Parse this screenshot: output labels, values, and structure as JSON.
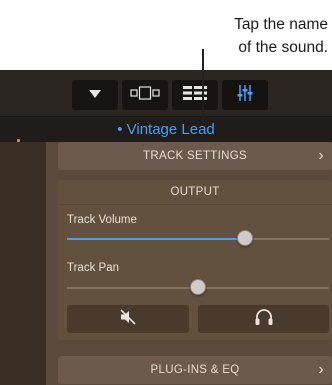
{
  "callout": {
    "text_line1": "Tap the name",
    "text_line2": "of the sound."
  },
  "toolbar": {
    "buttons": [
      {
        "icon": "dropdown-triangle-icon"
      },
      {
        "icon": "track-view-icon"
      },
      {
        "icon": "tracks-list-icon"
      },
      {
        "icon": "mixer-icon",
        "active": true
      }
    ]
  },
  "track": {
    "name": "• Vintage Lead"
  },
  "panel": {
    "track_settings_label": "TRACK SETTINGS",
    "output_label": "OUTPUT",
    "volume_label": "Track Volume",
    "volume_level": 0.68,
    "pan_label": "Track Pan",
    "pan_level": 0.5,
    "plugins_label": "PLUG-INS & EQ",
    "chevron": "›",
    "mute_icon": "speaker-muted-icon",
    "monitor_icon": "headphones-icon"
  },
  "colors": {
    "accent": "#4a9ff5",
    "mute_accent": "#f08a24"
  }
}
